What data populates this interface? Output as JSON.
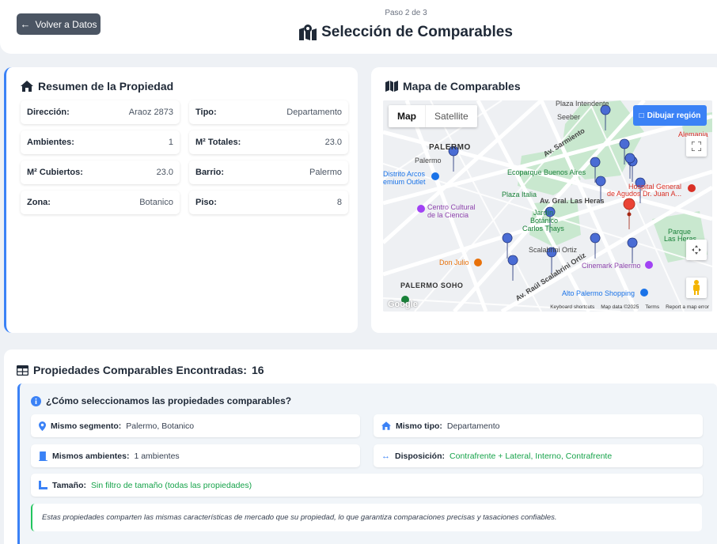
{
  "header": {
    "back_label": "Volver a Datos",
    "step": "Paso 2 de 3",
    "title": "Selección de Comparables"
  },
  "summary": {
    "title": "Resumen de la Propiedad",
    "fields": [
      {
        "label": "Dirección:",
        "value": "Araoz 2873"
      },
      {
        "label": "Tipo:",
        "value": "Departamento"
      },
      {
        "label": "Ambientes:",
        "value": "1"
      },
      {
        "label": "M² Totales:",
        "value": "23.0"
      },
      {
        "label": "M² Cubiertos:",
        "value": "23.0"
      },
      {
        "label": "Barrio:",
        "value": "Palermo"
      },
      {
        "label": "Zona:",
        "value": "Botanico"
      },
      {
        "label": "Piso:",
        "value": "8"
      }
    ]
  },
  "map": {
    "title": "Mapa de Comparables",
    "toggle_map": "Map",
    "toggle_satellite": "Satellite",
    "draw_region": "Dibujar región",
    "labels": {
      "palermo": "PALERMO",
      "palermo_soho": "PALERMO SOHO",
      "palermo_station": "Palermo",
      "distrito_arcos": "Distrito Arcos",
      "premium_outlet": "emium Outlet",
      "ecoparque": "Ecoparque Buenos Aires",
      "plaza_italia": "Plaza Italia",
      "av_heras": "Av. Gral. Las Heras",
      "centro_cultural_1": "Centro Cultural",
      "centro_cultural_2": "de la Ciencia",
      "jardin_1": "Jardín",
      "jardin_2": "Botánico",
      "jardin_3": "Carlos Thays",
      "scalabrini": "Scalabrini Ortiz",
      "don_julio": "Don Julio",
      "cinemark": "Cinemark Palermo",
      "alto_palermo": "Alto Palermo Shopping",
      "hospital_1": "Hospital General",
      "hospital_2": "de Agudos Dr. Juan A...",
      "parque_heras_1": "Parque",
      "parque_heras_2": "Las Heras",
      "alemania": "Alemania",
      "plaza_intendente": "Plaza Intendente",
      "seeber": "Seeber",
      "av_sarmiento": "Av. Sarmiento",
      "av_raul": "Av. Raúl Scalabrini Ortiz"
    },
    "footer": [
      "Keyboard shortcuts",
      "Map data ©2025",
      "Terms",
      "Report a map error"
    ],
    "google": "Google"
  },
  "comparables": {
    "title": "Propiedades Comparables Encontradas:",
    "count": "16",
    "info_title": "¿Cómo seleccionamos las propiedades comparables?",
    "criteria": {
      "segment_label": "Mismo segmento:",
      "segment_value": "Palermo, Botanico",
      "type_label": "Mismo tipo:",
      "type_value": "Departamento",
      "rooms_label": "Mismos ambientes:",
      "rooms_value": "1 ambientes",
      "disposition_label": "Disposición:",
      "disposition_value": "Contrafrente + Lateral, Interno, Contrafrente",
      "size_label": "Tamaño:",
      "size_value": "Sin filtro de tamaño (todas las propiedades)"
    },
    "note": "Estas propiedades comparten las mismas características de mercado que su propiedad, lo que garantiza comparaciones precisas y tasaciones confiables."
  },
  "colors": {
    "accent": "#3b82f6",
    "back_button": "#4b5563",
    "green_text": "#16a34a",
    "marker_blue": "#4a6cd4",
    "marker_red": "#ea4335"
  }
}
